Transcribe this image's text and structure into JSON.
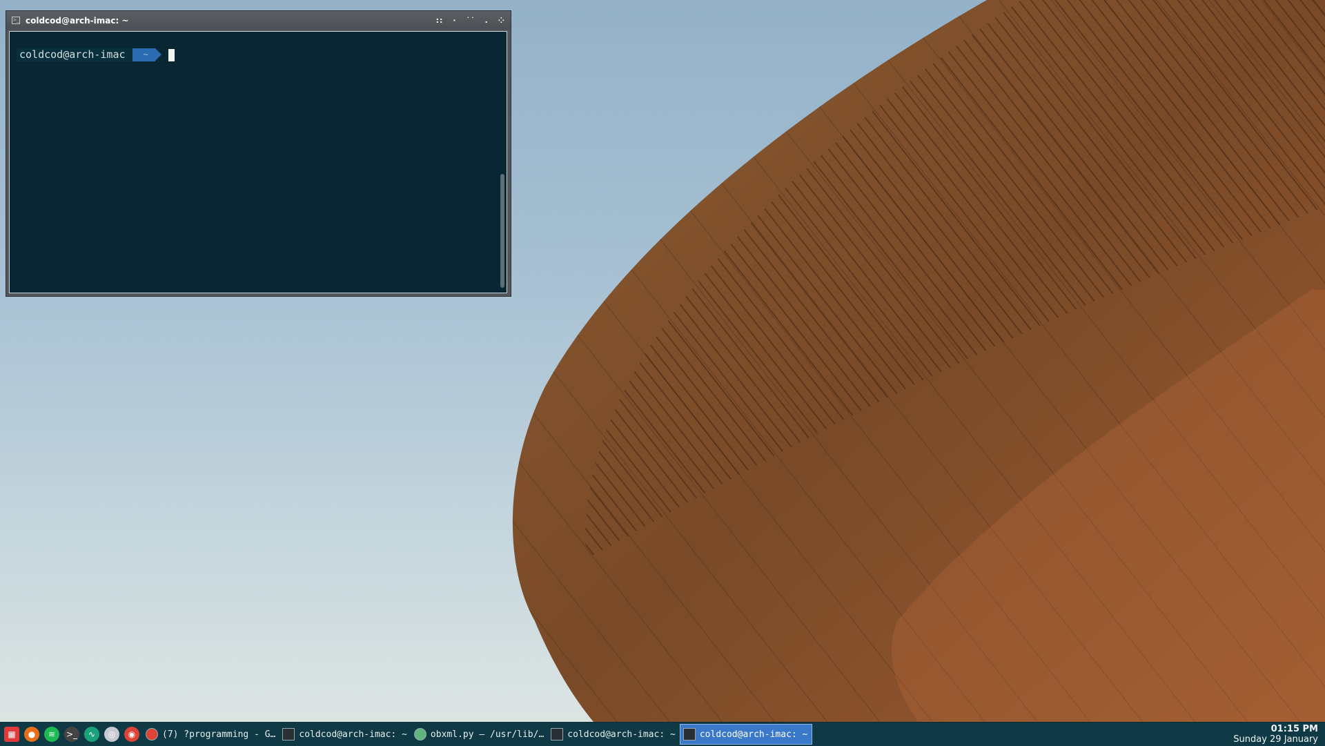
{
  "window": {
    "title": "coldcod@arch-imac: ~",
    "controls": [
      "::",
      "·",
      "˙˙",
      ".",
      "⁘"
    ]
  },
  "terminal": {
    "prompt_user": "coldcod@arch-imac",
    "prompt_dir": "~"
  },
  "taskbar": {
    "launchers": [
      {
        "name": "app-menu-icon",
        "color": "#e03a3a",
        "glyph": "▦"
      },
      {
        "name": "firefox-icon",
        "color": "#e8701c",
        "glyph": "●"
      },
      {
        "name": "spotify-icon",
        "color": "#1db954",
        "glyph": "≋"
      },
      {
        "name": "terminal-icon",
        "color": "#444",
        "glyph": ">_"
      },
      {
        "name": "system-monitor-icon",
        "color": "#1aa37a",
        "glyph": "∿"
      },
      {
        "name": "settings-icon",
        "color": "#c8c8d0",
        "glyph": "◎"
      },
      {
        "name": "chrome-icon",
        "color": "#db4437",
        "glyph": "◉"
      }
    ],
    "tasks": [
      {
        "label": "(7) ?programming - G…",
        "icon": "chrome-icon",
        "active": false
      },
      {
        "label": "coldcod@arch-imac: ~",
        "icon": "terminal-icon",
        "active": false
      },
      {
        "label": "obxml.py — /usr/lib/…",
        "icon": "atom-icon",
        "active": false
      },
      {
        "label": "coldcod@arch-imac: ~",
        "icon": "terminal-icon",
        "active": false
      },
      {
        "label": "coldcod@arch-imac: ~",
        "icon": "terminal-icon",
        "active": true
      }
    ],
    "clock": {
      "time": "01:15 PM",
      "date": "Sunday 29 January"
    }
  },
  "colors": {
    "terminal_bg": "#082733",
    "taskbar_bg": "#0f3a45",
    "active_task": "#3a78c9",
    "prompt_dir_bg": "#2b6cb0"
  }
}
